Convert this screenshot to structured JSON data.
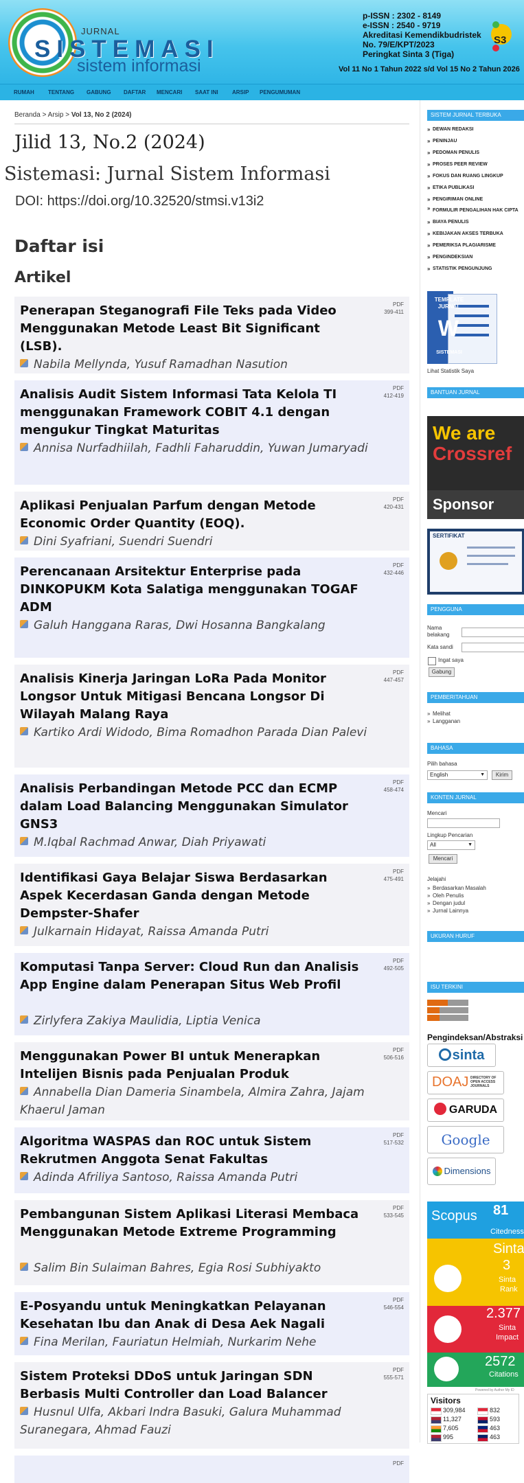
{
  "header": {
    "logo_journal": "JURNAL",
    "logo_title": "SISTEMASI",
    "logo_subtitle": "sistem informasi",
    "issn_lines": [
      "p-ISSN : 2302 - 8149",
      "e-ISSN : 2540 - 9719",
      "Akreditasi Kemendikbudristek",
      "No. 79/E/KPT/2023",
      "Peringkat Sinta 3 (Tiga)"
    ],
    "volume_range": "Vol 11 No 1 Tahun 2022 s/d Vol 15 No 2 Tahun 2026",
    "sinta_badge": "S3"
  },
  "nav": [
    "RUMAH",
    "TENTANG",
    "GABUNG",
    "DAFTAR",
    "MENCARI",
    "SAAT INI",
    "ARSIP",
    "PENGUMUMAN"
  ],
  "breadcrumb": {
    "home": "Beranda",
    "sep": ">",
    "archive": "Arsip",
    "current": "Vol 13, No 2 (2024)"
  },
  "issue_title": "Jilid 13, No.2 (2024)",
  "journal_name": "Sistemasi: Jurnal Sistem Informasi",
  "doi": "DOI: https://doi.org/10.32520/stmsi.v13i2",
  "toc_heading": "Daftar isi",
  "section_heading": "Artikel",
  "articles": [
    {
      "title": "Penerapan Steganografi File Teks pada Video Menggunakan Metode Least Bit Significant (LSB).",
      "pdf": "PDF",
      "pages": "399-411",
      "authors": "Nabila Mellynda, Yusuf Ramadhan Nasution"
    },
    {
      "title": "Analisis Audit Sistem Informasi Tata Kelola TI menggunakan Framework COBIT 4.1 dengan mengukur Tingkat Maturitas",
      "pdf": "PDF",
      "pages": "412-419",
      "authors": "Annisa Nurfadhiilah, Fadhli Faharuddin, Yuwan Jumaryadi"
    },
    {
      "title": "Aplikasi Penjualan Parfum dengan Metode Economic Order Quantity (EOQ).",
      "pdf": "PDF",
      "pages": "420-431",
      "authors": "Dini Syafriani, Suendri Suendri"
    },
    {
      "title": "Perencanaan Arsitektur Enterprise pada DINKOPUKM Kota Salatiga menggunakan TOGAF ADM",
      "pdf": "PDF",
      "pages": "432-446",
      "authors": "Galuh Hanggana Raras, Dwi Hosanna Bangkalang"
    },
    {
      "title": "Analisis Kinerja Jaringan LoRa Pada Monitor Longsor Untuk Mitigasi Bencana Longsor Di Wilayah Malang Raya",
      "pdf": "PDF",
      "pages": "447-457",
      "authors": "Kartiko Ardi Widodo, Bima Romadhon Parada Dian Palevi"
    },
    {
      "title": "Analisis Perbandingan Metode PCC dan ECMP dalam Load Balancing Menggunakan Simulator GNS3",
      "pdf": "PDF",
      "pages": "458-474",
      "authors": "M.Iqbal Rachmad Anwar, Diah Priyawati"
    },
    {
      "title": "Identifikasi Gaya Belajar Siswa Berdasarkan Aspek Kecerdasan Ganda dengan Metode Dempster-Shafer",
      "pdf": "PDF",
      "pages": "475-491",
      "authors": "Julkarnain Hidayat, Raissa Amanda Putri"
    },
    {
      "title": "Komputasi Tanpa Server: Cloud Run dan Analisis App Engine dalam Penerapan Situs Web Profil",
      "pdf": "PDF",
      "pages": "492-505",
      "authors": "Zirlyfera Zakiya Maulidia, Liptia Venica"
    },
    {
      "title": "Menggunakan Power BI untuk Menerapkan Intelijen Bisnis pada Penjualan Produk",
      "pdf": "PDF",
      "pages": "506-516",
      "authors": "Annabella Dian Dameria Sinambela, Almira Zahra, Jajam Khaerul Jaman"
    },
    {
      "title": "Algoritma WASPAS dan ROC untuk Sistem Rekrutmen Anggota Senat Fakultas",
      "pdf": "PDF",
      "pages": "517-532",
      "authors": "Adinda Afriliya Santoso, Raissa Amanda Putri"
    },
    {
      "title": "Pembangunan Sistem Aplikasi Literasi Membaca Menggunakan Metode Extreme Programming",
      "pdf": "PDF",
      "pages": "533-545",
      "authors": "Salim Bin Sulaiman Bahres, Egia Rosi Subhiyakto"
    },
    {
      "title": "E-Posyandu untuk Meningkatkan Pelayanan Kesehatan Ibu dan Anak di Desa Aek Nagali",
      "pdf": "PDF",
      "pages": "546-554",
      "authors": "Fina Merilan, Fauriatun Helmiah, Nurkarim Nehe"
    },
    {
      "title": "Sistem Proteksi DDoS untuk Jaringan SDN Berbasis Multi Controller dan Load Balancer",
      "pdf": "PDF",
      "pages": "555-571",
      "authors": "Husnul Ulfa, Akbari Indra Basuki, Galura Muhammad Suranegara, Ahmad Fauzi"
    },
    {
      "title": "",
      "pdf": "PDF",
      "pages": "",
      "authors": ""
    }
  ],
  "sidebar": {
    "open_journal_head": "SISTEM JURNAL TERBUKA",
    "menu": [
      "DEWAN REDAKSI",
      "PENINJAU",
      "PEDOMAN PENULIS",
      "PROSES PEER REVIEW",
      "FOKUS DAN RUANG LINGKUP",
      "ETIKA PUBLIKASI",
      "PENGIRIMAN ONLINE",
      "FORMULIR PENGALIHAN HAK CIPTA",
      "BIAYA PENULIS",
      "KEBIJAKAN AKSES TERBUKA",
      "PEMERIKSA PLAGIARISME",
      "PENGINDEKSIAN",
      "STATISTIK PENGUNJUNG"
    ],
    "template_label": [
      "TEMPLATE",
      "JURNAL",
      "W",
      "SISTEMASI"
    ],
    "stats_link": "Lihat Statistik Saya",
    "help_head": "BANTUAN JURNAL",
    "crossref": [
      "We are",
      "Crossref",
      "Sponsor"
    ],
    "certificate_label": "SERTIFIKAT",
    "user_head": "PENGGUNA",
    "username_label": "Nama belakang",
    "password_label": "Kata sandi",
    "remember_label": "Ingat saya",
    "login_button": "Gabung",
    "notification_head": "PEMBERITAHUAN",
    "notification_items": [
      "Melihat",
      "Langganan"
    ],
    "language_head": "BAHASA",
    "language_label": "Pilih bahasa",
    "language_value": "English",
    "language_button": "Kirim",
    "content_head": "KONTEN JURNAL",
    "search_label": "Mencari",
    "scope_label": "Lingkup Pencarian",
    "scope_value": "All",
    "search_button": "Mencari",
    "browse_label": "Jelajahi",
    "browse_items": [
      "Berdasarkan Masalah",
      "Oleh Penulis",
      "Dengan judul",
      "Jurnal Lainnya"
    ],
    "font_head": "UKURAN HURUF",
    "current_head": "ISU TERKINI",
    "indexing_head": "Pengindeksan/Abstraksi",
    "index_logos": [
      "sinta",
      "DOAJ",
      "DIRECTORY OF OPEN ACCESS JOURNALS",
      "GARUDA",
      "Google",
      "Dimensions"
    ],
    "scopus": {
      "label": "Scopus",
      "value": "81",
      "value_label": "Citedness"
    },
    "sinta": {
      "label": "Sinta",
      "rank": "3",
      "rank_label1": "Sinta",
      "rank_label2": "Rank",
      "impact": "2.377",
      "impact_label1": "Sinta",
      "impact_label2": "Impact",
      "citations": "2572",
      "citations_label": "Citations",
      "powered": "Powered by Author My ID"
    },
    "visitors_head": "Visitors",
    "visitors": [
      {
        "count": "309,984",
        "count2": "832"
      },
      {
        "count": "11,327",
        "count2": "593"
      },
      {
        "count": "7,605",
        "count2": "463"
      },
      {
        "count": "995",
        "count2": "463"
      }
    ]
  },
  "colors": {
    "header_top": "#8fe0f5",
    "header_bottom": "#2fb5e6",
    "nav": "#2bb3e4",
    "sidebar_head": "#3aa9e8",
    "scopus": "#1fa0e0",
    "sinta_yellow": "#f6c400",
    "sinta_red": "#e2283a",
    "sinta_green": "#23a65a"
  }
}
